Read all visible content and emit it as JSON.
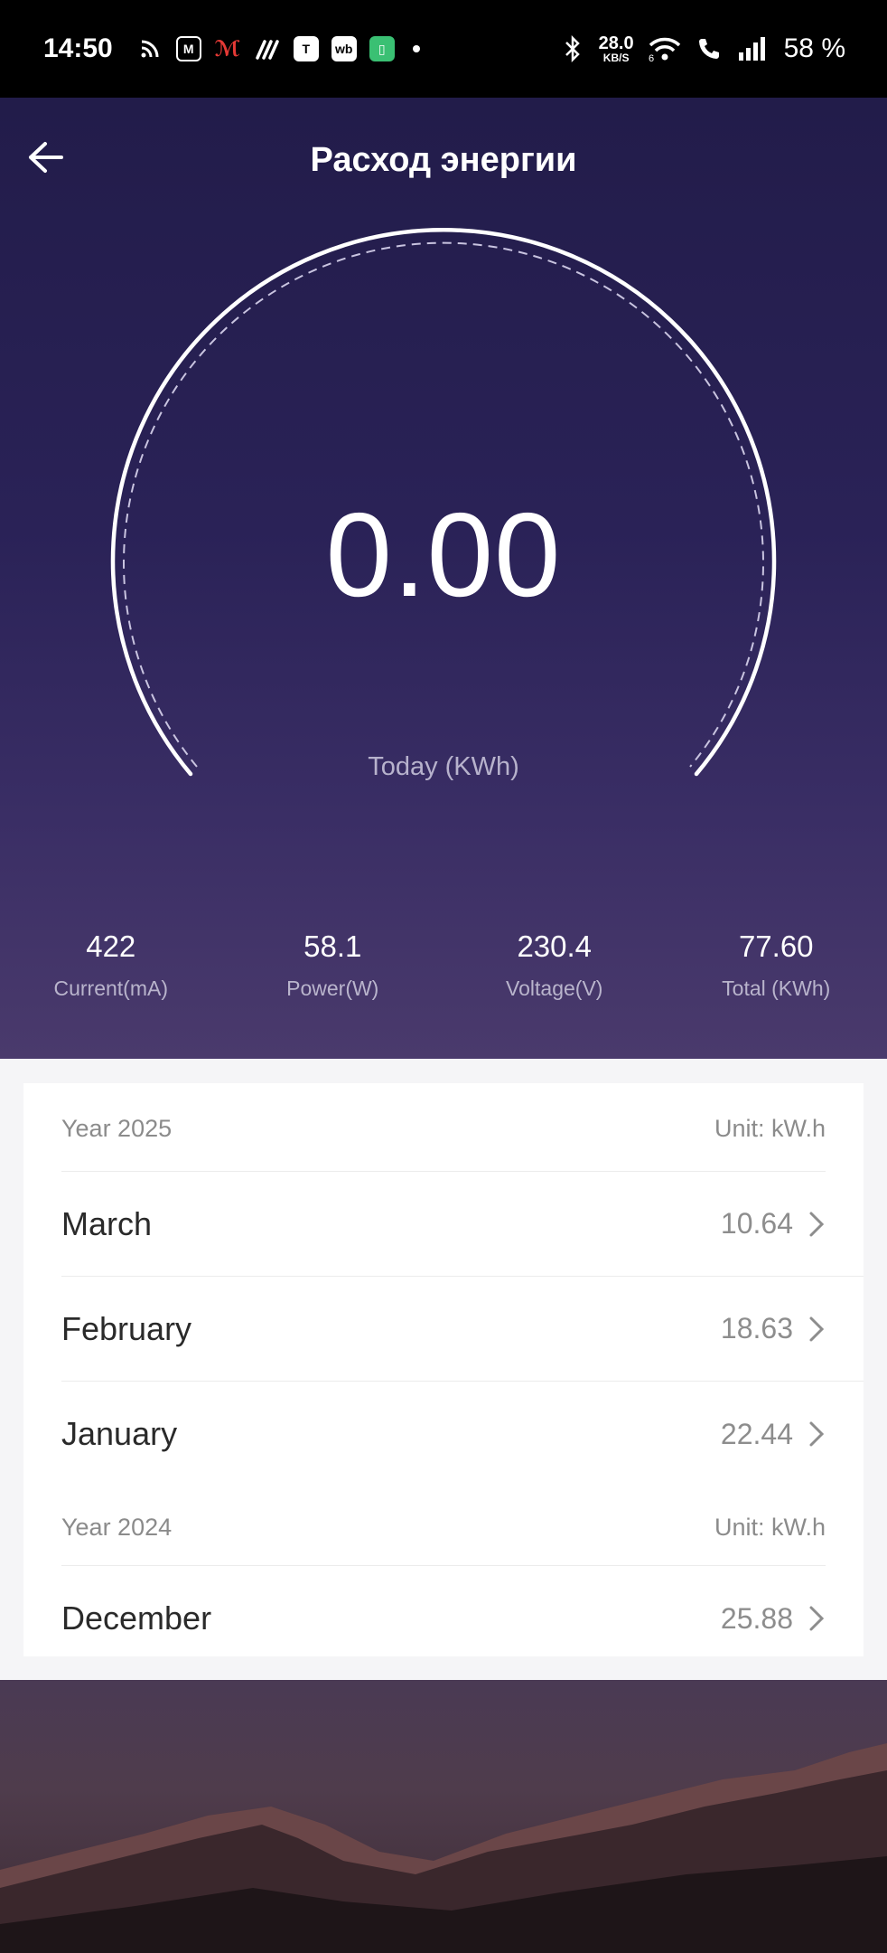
{
  "status_bar": {
    "time": "14:50",
    "speed_value": "28.0",
    "speed_unit": "KB/S",
    "network": "6",
    "battery": "58 %",
    "icons": [
      "rss-icon",
      "m-app-icon",
      "m-red-app-icon",
      "signal-app-icon",
      "t-app-icon",
      "wb-app-icon",
      "green-app-icon",
      "bluetooth-icon",
      "wifi-icon",
      "call-icon",
      "cell-signal-icon"
    ]
  },
  "header": {
    "title": "Расход энергии",
    "back_icon": "back-arrow-icon"
  },
  "gauge": {
    "value": "0.00",
    "label": "Today (KWh)"
  },
  "stats": [
    {
      "value": "422",
      "label": "Current(mA)"
    },
    {
      "value": "58.1",
      "label": "Power(W)"
    },
    {
      "value": "230.4",
      "label": "Voltage(V)"
    },
    {
      "value": "77.60",
      "label": "Total (KWh)"
    }
  ],
  "sections": [
    {
      "year": "Year 2025",
      "unit": "Unit: kW.h",
      "rows": [
        {
          "month": "March",
          "value": "10.64"
        },
        {
          "month": "February",
          "value": "18.63"
        },
        {
          "month": "January",
          "value": "22.44"
        }
      ]
    },
    {
      "year": "Year 2024",
      "unit": "Unit: kW.h",
      "rows": [
        {
          "month": "December",
          "value": "25.88"
        }
      ]
    }
  ],
  "colors": {
    "hero_top": "#221c4a",
    "hero_bottom": "#4a3a6c",
    "accent_text": "#ffffff",
    "muted_text": "#8b8b8b"
  }
}
